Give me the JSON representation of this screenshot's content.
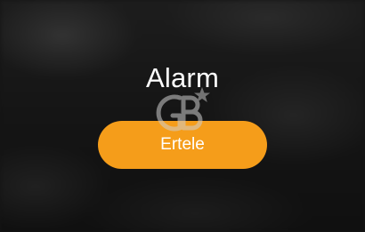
{
  "alarm": {
    "title": "Alarm",
    "postpone_label": "Ertele"
  },
  "watermark": {
    "text": "GB",
    "icon": "star-icon"
  },
  "colors": {
    "button": "#f59d1a",
    "background": "#141414",
    "text": "#ffffff"
  }
}
